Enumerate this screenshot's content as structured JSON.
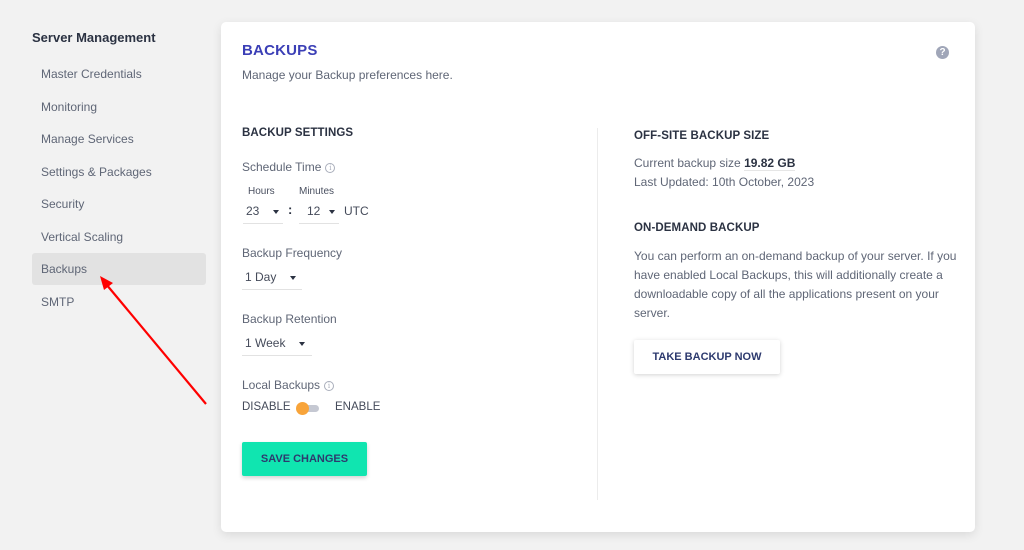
{
  "sidebar": {
    "title": "Server Management",
    "items": [
      {
        "label": "Master Credentials",
        "active": false
      },
      {
        "label": "Monitoring",
        "active": false
      },
      {
        "label": "Manage Services",
        "active": false
      },
      {
        "label": "Settings & Packages",
        "active": false
      },
      {
        "label": "Security",
        "active": false
      },
      {
        "label": "Vertical Scaling",
        "active": false
      },
      {
        "label": "Backups",
        "active": true
      },
      {
        "label": "SMTP",
        "active": false
      }
    ]
  },
  "header": {
    "title": "BACKUPS",
    "subtitle": "Manage your Backup preferences here.",
    "help_icon": "?"
  },
  "backup_settings": {
    "heading": "BACKUP SETTINGS",
    "schedule_time": {
      "label": "Schedule Time",
      "hours_label": "Hours",
      "minutes_label": "Minutes",
      "hours_value": "23",
      "minutes_value": "12",
      "separator": ":",
      "timezone": "UTC"
    },
    "frequency": {
      "label": "Backup Frequency",
      "value": "1 Day"
    },
    "retention": {
      "label": "Backup Retention",
      "value": "1 Week"
    },
    "local_backups": {
      "label": "Local Backups",
      "off_label": "DISABLE",
      "on_label": "ENABLE",
      "enabled": false
    },
    "save_button": "SAVE CHANGES"
  },
  "offsite": {
    "heading": "OFF-SITE BACKUP SIZE",
    "size_prefix": "Current backup size",
    "size_value": "19.82 GB",
    "last_updated": "Last Updated: 10th October, 2023"
  },
  "on_demand": {
    "heading": "ON-DEMAND BACKUP",
    "description": "You can perform an on-demand backup of your server. If you have enabled Local Backups, this will additionally create a downloadable copy of all the applications present on your server.",
    "button": "TAKE BACKUP NOW"
  },
  "colors": {
    "title_accent": "#3b3fb6",
    "save_button": "#10e5b0",
    "toggle_knob": "#f8a43a",
    "annotation_arrow": "#ff0000"
  }
}
